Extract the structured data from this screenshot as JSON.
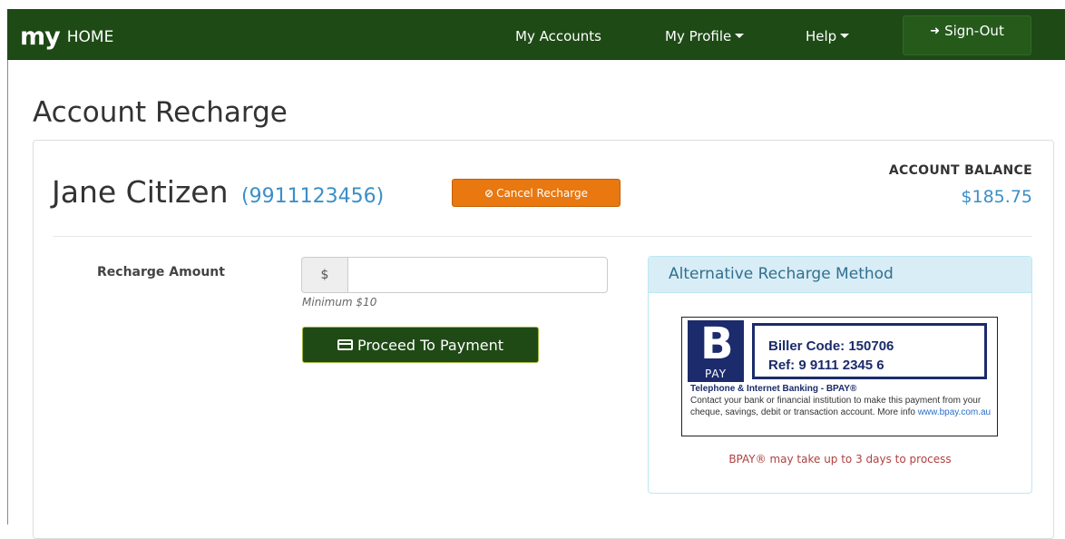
{
  "navbar": {
    "brand_logo": "my",
    "brand_home": "HOME",
    "my_accounts": "My Accounts",
    "my_profile": "My Profile",
    "help": "Help",
    "sign_out": "Sign-Out",
    "bg_color": "#1e4a16"
  },
  "page": {
    "title": "Account Recharge"
  },
  "customer": {
    "name": "Jane Citizen",
    "number": "(9911123456)",
    "cancel_label": "Cancel Recharge"
  },
  "balance": {
    "label": "ACCOUNT BALANCE",
    "value": "$185.75"
  },
  "recharge": {
    "amount_label": "Recharge Amount",
    "currency_symbol": "$",
    "amount_value": "",
    "minimum_note": "Minimum $10",
    "proceed_label": "Proceed To Payment"
  },
  "alternative": {
    "heading": "Alternative Recharge Method",
    "bpay_pay": "PAY",
    "biller_code": "Biller Code: 150706",
    "ref": "Ref: 9 9111 2345 6",
    "banking_heading": "Telephone & Internet Banking - BPAY®",
    "description": "Contact your bank or financial institution to make this payment from your cheque, savings, debit or transaction account. More info ",
    "link": "www.bpay.com.au",
    "note": "BPAY® may take up to 3 days to process"
  },
  "icons": {
    "signout": "sign-out-icon",
    "cancel": "ban-icon",
    "proceed": "credit-card-icon"
  }
}
